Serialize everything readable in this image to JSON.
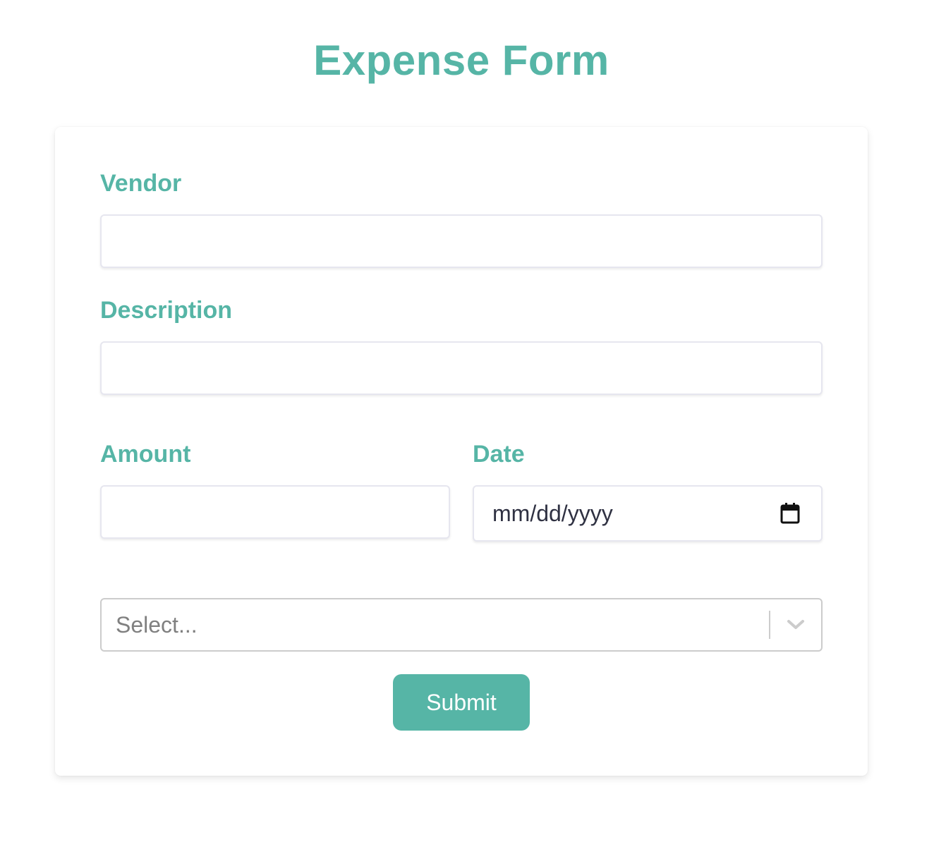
{
  "page_title": "Expense Form",
  "form": {
    "vendor": {
      "label": "Vendor",
      "value": "",
      "placeholder": ""
    },
    "description": {
      "label": "Description",
      "value": "",
      "placeholder": ""
    },
    "amount": {
      "label": "Amount",
      "value": "",
      "placeholder": ""
    },
    "date": {
      "label": "Date",
      "placeholder": "mm/dd/yyyy",
      "icon": "calendar-icon"
    },
    "category_select": {
      "selected": "Select...",
      "icon": "chevron-down-icon"
    },
    "submit_label": "Submit"
  },
  "colors": {
    "accent": "#56b5a6",
    "input_border": "#e6e6ef",
    "select_border": "#cccccc",
    "placeholder_text": "#808080"
  }
}
